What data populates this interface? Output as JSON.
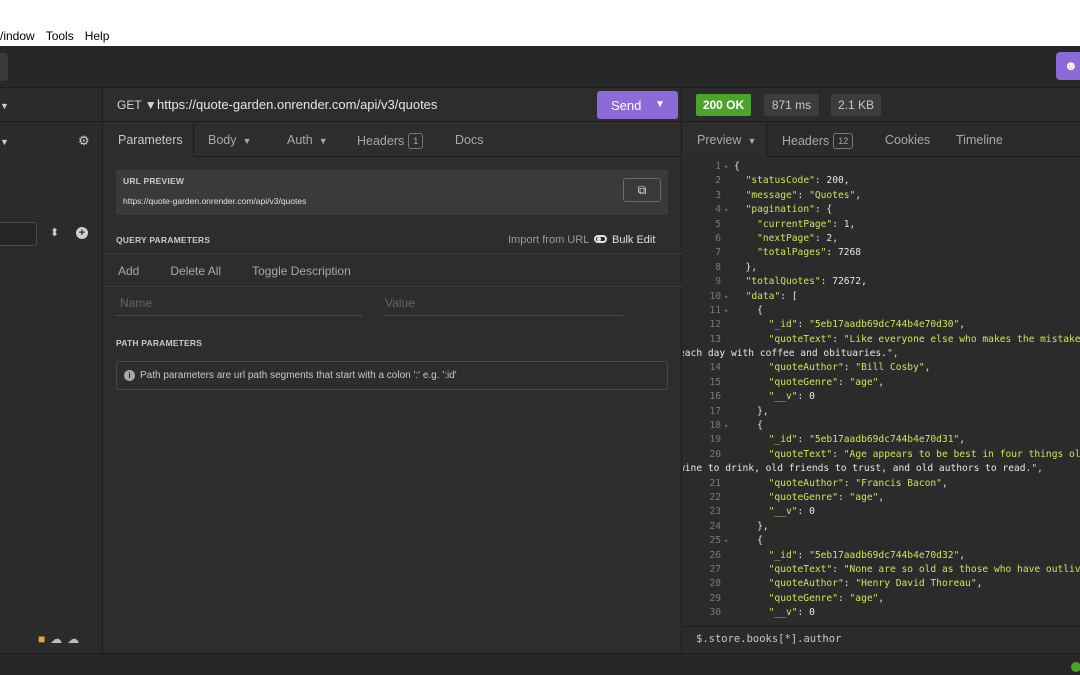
{
  "menu": [
    "Window",
    "Tools",
    "Help"
  ],
  "menu_display": [
    "/indow",
    "Tools",
    "Help"
  ],
  "colors": {
    "accent": "#8c6bd9",
    "status_ok": "#4ea32c",
    "json_string": "#d6e05a"
  },
  "request": {
    "method": "GET",
    "url": "https://quote-garden.onrender.com/api/v3/quotes",
    "send_label": "Send",
    "tabs": [
      {
        "label": "Parameters"
      },
      {
        "label": "Body"
      },
      {
        "label": "Auth"
      },
      {
        "label": "Headers",
        "count": "1"
      },
      {
        "label": "Docs"
      }
    ],
    "url_preview_title": "URL PREVIEW",
    "url_preview": "https://quote-garden.onrender.com/api/v3/quotes",
    "query_title": "QUERY PARAMETERS",
    "import_url": "Import from URL",
    "bulk_edit": "Bulk Edit",
    "actions": [
      "Add",
      "Delete All",
      "Toggle Description"
    ],
    "name_placeholder": "Name",
    "value_placeholder": "Value",
    "path_title": "PATH PARAMETERS",
    "path_notice": "Path parameters are url path segments that start with a colon ':' e.g. ':id'"
  },
  "response": {
    "status": "200 OK",
    "time": "871 ms",
    "size": "2.1 KB",
    "tabs": [
      {
        "label": "Preview"
      },
      {
        "label": "Headers",
        "count": "12"
      },
      {
        "label": "Cookies"
      },
      {
        "label": "Timeline"
      }
    ],
    "filter": "$.store.books[*].author",
    "lines": [
      {
        "n": "1",
        "fold": true,
        "t": "{"
      },
      {
        "n": "2",
        "t": "  \"statusCode\": 200,"
      },
      {
        "n": "3",
        "t": "  \"message\": \"Quotes\","
      },
      {
        "n": "4",
        "fold": true,
        "t": "  \"pagination\": {"
      },
      {
        "n": "5",
        "t": "    \"currentPage\": 1,"
      },
      {
        "n": "6",
        "t": "    \"nextPage\": 2,"
      },
      {
        "n": "7",
        "t": "    \"totalPages\": 7268"
      },
      {
        "n": "8",
        "t": "  },"
      },
      {
        "n": "9",
        "t": "  \"totalQuotes\": 72672,"
      },
      {
        "n": "10",
        "fold": true,
        "t": "  \"data\": ["
      },
      {
        "n": "11",
        "fold": true,
        "t": "    {"
      },
      {
        "n": "12",
        "t": "      \"_id\": \"5eb17aadb69dc744b4e70d30\","
      },
      {
        "n": "13",
        "t": "      \"quoteText\": \"Like everyone else who makes the mistake of",
        "cont": "each day with coffee and obituaries.\","
      },
      {
        "n": "14",
        "t": "      \"quoteAuthor\": \"Bill Cosby\","
      },
      {
        "n": "15",
        "t": "      \"quoteGenre\": \"age\","
      },
      {
        "n": "16",
        "t": "      \"__v\": 0"
      },
      {
        "n": "17",
        "t": "    },"
      },
      {
        "n": "18",
        "fold": true,
        "t": "    {"
      },
      {
        "n": "19",
        "t": "      \"_id\": \"5eb17aadb69dc744b4e70d31\","
      },
      {
        "n": "20",
        "t": "      \"quoteText\": \"Age appears to be best in four things old",
        "cont": "wine to drink, old friends to trust, and old authors to read.\","
      },
      {
        "n": "21",
        "t": "      \"quoteAuthor\": \"Francis Bacon\","
      },
      {
        "n": "22",
        "t": "      \"quoteGenre\": \"age\","
      },
      {
        "n": "23",
        "t": "      \"__v\": 0"
      },
      {
        "n": "24",
        "t": "    },"
      },
      {
        "n": "25",
        "fold": true,
        "t": "    {"
      },
      {
        "n": "26",
        "t": "      \"_id\": \"5eb17aadb69dc744b4e70d32\","
      },
      {
        "n": "27",
        "t": "      \"quoteText\": \"None are so old as those who have outlived"
      },
      {
        "n": "28",
        "t": "      \"quoteAuthor\": \"Henry David Thoreau\","
      },
      {
        "n": "29",
        "t": "      \"quoteGenre\": \"age\","
      },
      {
        "n": "30",
        "t": "      \"__v\": 0"
      }
    ]
  }
}
